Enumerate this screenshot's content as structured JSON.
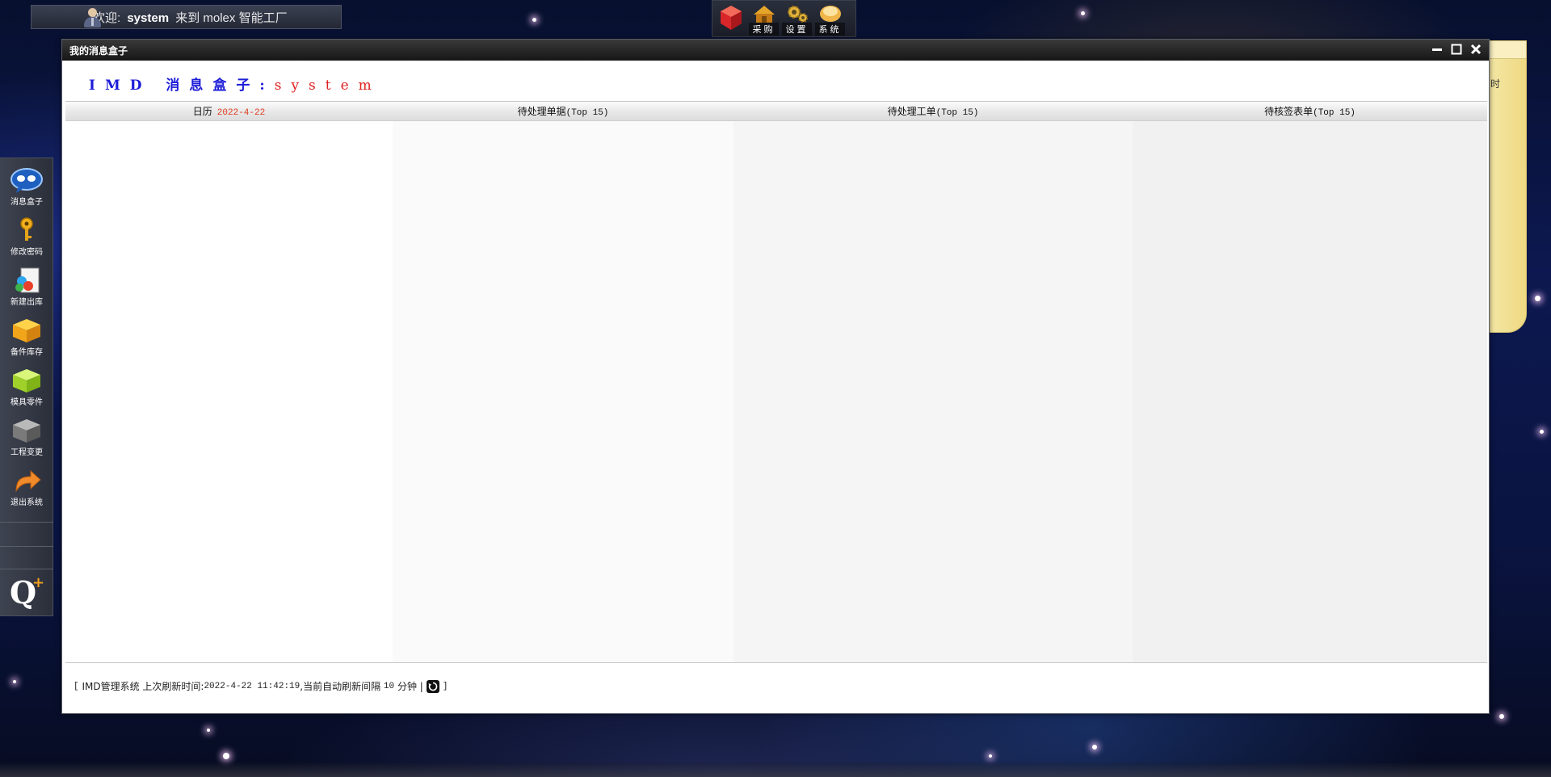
{
  "welcome": {
    "prefix": "欢迎:",
    "username": "system",
    "suffix": "来到 molex 智能工厂"
  },
  "top_apps": [
    {
      "label": "",
      "icon": "red-cube-icon"
    },
    {
      "label": "采购",
      "icon": "purchase-icon"
    },
    {
      "label": "设置",
      "icon": "gears-icon"
    },
    {
      "label": "系统",
      "icon": "system-icon"
    }
  ],
  "dock": [
    {
      "label": "消息盒子",
      "icon": "chat-bubbles-icon"
    },
    {
      "label": "修改密码",
      "icon": "key-icon"
    },
    {
      "label": "新建出库",
      "icon": "new-document-icon"
    },
    {
      "label": "备件库存",
      "icon": "box-icon"
    },
    {
      "label": "模具零件",
      "icon": "green-box-icon"
    },
    {
      "label": "工程变更",
      "icon": "gray-box-icon"
    },
    {
      "label": "退出系统",
      "icon": "exit-arrow-icon"
    }
  ],
  "sticky_note": {
    "text": "时"
  },
  "window": {
    "title": "我的消息盒子",
    "header_prefix": "IMD 消息盒子:",
    "header_user": "system"
  },
  "panels": [
    {
      "title": "日历",
      "date": "2022-4-22"
    },
    {
      "title": "待处理单据",
      "suffix": "(Top 15)"
    },
    {
      "title": "待处理工单",
      "suffix": "(Top 15)"
    },
    {
      "title": "待核签表单",
      "suffix": "(Top 15)"
    }
  ],
  "status": {
    "open": "[",
    "system": "IMD管理系统 上次刷新时间:",
    "last_refresh": "2022-4-22 11:42:19",
    "interval_text": ",当前自动刷新间隔",
    "interval": "10",
    "unit": "分钟",
    "sep": "|",
    "close": "]"
  }
}
